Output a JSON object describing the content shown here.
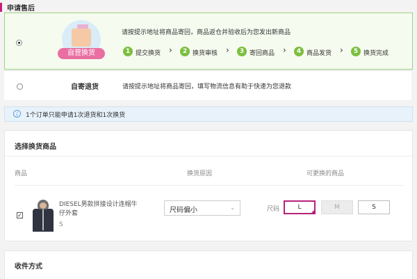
{
  "header": {
    "title": "申请售后"
  },
  "options": {
    "exchange": {
      "badge_label": "自营换货",
      "description": "请按提示地址将商品寄回，商品返仓并验收后为您发出新商品",
      "steps": [
        {
          "num": "1",
          "label": "提交换货"
        },
        {
          "num": "2",
          "label": "换货审核"
        },
        {
          "num": "3",
          "label": "寄回商品"
        },
        {
          "num": "4",
          "label": "商品发货"
        },
        {
          "num": "5",
          "label": "换货完成"
        }
      ],
      "arrow": "›"
    },
    "return": {
      "title": "自寄退货",
      "description": "请按提示地址将商品寄回，填写物流信息有助于快速为您退款"
    }
  },
  "info": {
    "icon": "i",
    "text": "1个订单只能申请1次退货和1次换货"
  },
  "product_section": {
    "title": "选择换货商品",
    "headers": {
      "product": "商品",
      "reason": "换货原因",
      "exchangeable": "可更换的商品"
    },
    "item": {
      "checked_mark": "✓",
      "name": "DIESEL男款拼接设计连帽牛仔外套",
      "size": "S",
      "reason_value": "尺码偏小",
      "reason_caret": "⌄",
      "size_label": "尺码",
      "size_options": [
        "L",
        "M",
        "S"
      ]
    }
  },
  "shipping": {
    "title": "收件方式"
  },
  "colors": {
    "accent": "#b5217a",
    "green": "#7bbf3f",
    "brand_pink": "#c81d78"
  }
}
